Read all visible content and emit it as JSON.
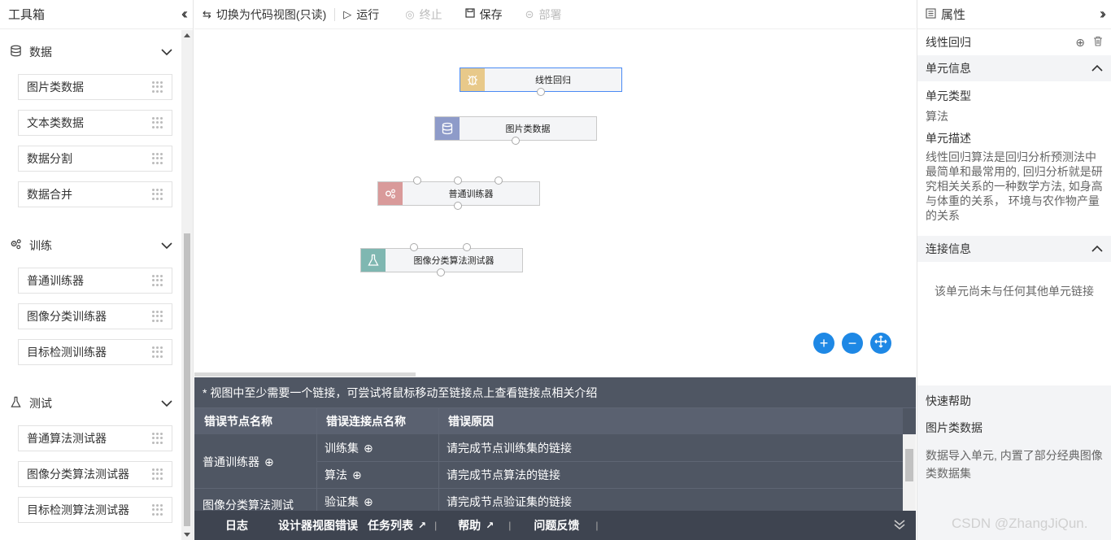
{
  "toolbox": {
    "title": "工具箱",
    "collapse_icon": "double-chevron-left-icon",
    "groups": [
      {
        "label": "数据",
        "icon": "database-icon",
        "items": [
          "图片类数据",
          "文本类数据",
          "数据分割",
          "数据合并"
        ]
      },
      {
        "label": "训练",
        "icon": "gears-icon",
        "items": [
          "普通训练器",
          "图像分类训练器",
          "目标检测训练器"
        ]
      },
      {
        "label": "测试",
        "icon": "flask-icon",
        "items": [
          "普通算法测试器",
          "图像分类算法测试器",
          "目标检测算法测试器"
        ]
      }
    ]
  },
  "topbar": {
    "switch_label": "切换为代码视图(只读)",
    "run_label": "运行",
    "stop_label": "终止",
    "save_label": "保存",
    "deploy_label": "部署"
  },
  "canvas": {
    "nodes": [
      {
        "label": "线性回归",
        "icon": "bug-icon",
        "color": "#e8c98a",
        "selected": true
      },
      {
        "label": "图片类数据",
        "icon": "database-icon",
        "color": "#8e9bc9"
      },
      {
        "label": "普通训练器",
        "icon": "gears-icon",
        "color": "#d99a9a"
      },
      {
        "label": "图像分类算法测试器",
        "icon": "flask-icon",
        "color": "#7fb7b1"
      }
    ]
  },
  "errors": {
    "hint": "* 视图中至少需要一个链接，可尝试将鼠标移动至链接点上查看链接点相关介绍",
    "columns": [
      "错误节点名称",
      "错误连接点名称",
      "错误原因"
    ],
    "groups": [
      {
        "node": "普通训练器",
        "rows": [
          {
            "point": "训练集",
            "reason": "请完成节点训练集的链接"
          },
          {
            "point": "算法",
            "reason": "请完成节点算法的链接"
          }
        ]
      },
      {
        "node": "图像分类算法测试",
        "rows": [
          {
            "point": "验证集",
            "reason": "请完成节点验证集的链接"
          }
        ]
      }
    ]
  },
  "bottom_tabs": {
    "log": "日志",
    "designer_errors": "设计器视图错误",
    "task_list": "任务列表",
    "help": "帮助",
    "feedback": "问题反馈",
    "separator": "|"
  },
  "properties": {
    "title": "属性",
    "node_name": "线性回归",
    "unit_info": {
      "title": "单元信息",
      "type_label": "单元类型",
      "type_value": "算法",
      "desc_label": "单元描述",
      "desc_value": "线性回归算法是回归分析预测法中最简单和最常用的, 回归分析就是研究相关关系的一种数学方法, 如身高与体重的关系， 环境与农作物产量的关系"
    },
    "link_info": {
      "title": "连接信息",
      "message": "该单元尚未与任何其他单元链接"
    },
    "quick_help": {
      "title": "快速帮助",
      "subject": "图片类数据",
      "text": "数据导入单元, 内置了部分经典图像类数据集"
    }
  },
  "watermark": "CSDN @ZhangJiQun.",
  "colors": {
    "accent": "#1e88e5",
    "error_panel": "#4f5663",
    "tabs_bar": "#3e4450"
  }
}
